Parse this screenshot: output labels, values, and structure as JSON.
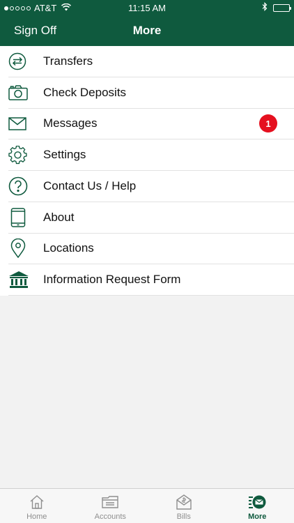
{
  "status": {
    "carrier": "AT&T",
    "time": "11:15 AM",
    "wifi_icon": "wifi-icon",
    "bluetooth_icon": "bluetooth-icon",
    "battery_icon": "battery-icon"
  },
  "nav": {
    "left_button": "Sign Off",
    "title": "More"
  },
  "menu": {
    "items": [
      {
        "label": "Transfers",
        "icon": "transfer-arrows-icon"
      },
      {
        "label": "Check Deposits",
        "icon": "camera-icon"
      },
      {
        "label": "Messages",
        "icon": "envelope-icon",
        "badge": "1"
      },
      {
        "label": "Settings",
        "icon": "gear-icon"
      },
      {
        "label": "Contact Us / Help",
        "icon": "question-circle-icon"
      },
      {
        "label": "About",
        "icon": "phone-device-icon"
      },
      {
        "label": "Locations",
        "icon": "map-pin-icon"
      },
      {
        "label": "Information Request Form",
        "icon": "bank-building-icon"
      }
    ]
  },
  "tabs": [
    {
      "label": "Home",
      "icon": "house-icon"
    },
    {
      "label": "Accounts",
      "icon": "folder-icon"
    },
    {
      "label": "Bills",
      "icon": "bill-envelope-icon"
    },
    {
      "label": "More",
      "icon": "more-list-icon",
      "active": true
    }
  ],
  "colors": {
    "brand": "#0f5a3e",
    "badge": "#e5101f",
    "tab_inactive": "#8e8e8e"
  }
}
